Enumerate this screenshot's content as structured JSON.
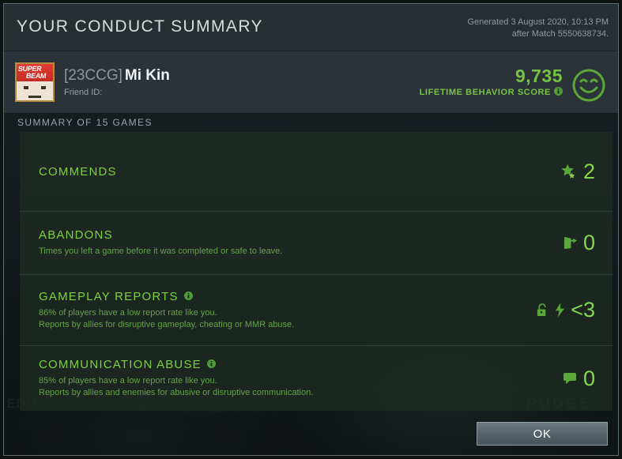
{
  "window": {
    "title": "YOUR CONDUCT SUMMARY",
    "generated_line1": "Generated 3 August 2020, 10:13 PM",
    "generated_line2": "after Match 5550638734."
  },
  "profile": {
    "clan_tag": "[23CCG]",
    "player_name": "Mi Kin",
    "friend_id_label": "Friend ID:",
    "avatar": {
      "word_top": "SUPER",
      "word_bottom": "BEAM",
      "name": "super-beam-avatar"
    },
    "behavior_score": "9,735",
    "behavior_score_label": "LIFETIME BEHAVIOR SCORE",
    "mood_icon": "smiley-face-icon"
  },
  "summary": {
    "header": "SUMMARY OF 15 GAMES",
    "rows": [
      {
        "id": "commends",
        "title": "COMMENDS",
        "sub1": "",
        "sub2": "",
        "has_info": false,
        "icons": [
          "star-icon"
        ],
        "value": "2"
      },
      {
        "id": "abandons",
        "title": "ABANDONS",
        "sub1": "Times you left a game before it was completed or safe to leave.",
        "sub2": "",
        "has_info": false,
        "icons": [
          "door-exit-icon"
        ],
        "value": "0"
      },
      {
        "id": "gameplay-reports",
        "title": "GAMEPLAY REPORTS",
        "sub1": "86% of players have a low report rate like you.",
        "sub2": "Reports by allies for disruptive gameplay, cheating or MMR abuse.",
        "has_info": true,
        "icons": [
          "lock-icon",
          "lightning-bolt-icon"
        ],
        "value": "<3"
      },
      {
        "id": "communication-abuse",
        "title": "COMMUNICATION ABUSE",
        "sub1": "85% of players have a low report rate like you.",
        "sub2": "Reports by allies and enemies for abusive or disruptive communication.",
        "has_info": true,
        "icons": [
          "speech-bubble-icon"
        ],
        "value": "0"
      }
    ]
  },
  "footer": {
    "ok_label": "OK"
  },
  "background": {
    "watermark_hero": "PUDGE",
    "watermark_updated": "Updated 3 August 2020, 10:13 PM",
    "watermark_edit": "EDIT"
  },
  "colors": {
    "accent_green": "#7ed13f",
    "value_green": "#84d84a",
    "sub_green": "#65a34a",
    "title_bar": "#282f33",
    "profile_bar": "#2c3338",
    "panel": "rgba(32,48,36,0.62)"
  }
}
